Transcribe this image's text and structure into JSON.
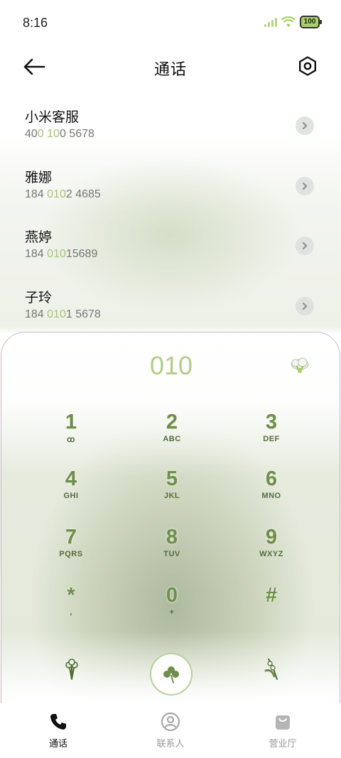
{
  "status": {
    "time": "8:16",
    "battery": "100"
  },
  "header": {
    "title": "通话"
  },
  "contacts": [
    {
      "name": "小米客服",
      "number_parts": [
        "40",
        "0",
        " ",
        "10",
        "0 5678"
      ]
    },
    {
      "name": "雅娜",
      "number_parts": [
        "184 ",
        "010",
        "2 4685"
      ]
    },
    {
      "name": "燕婷",
      "number_parts": [
        "184 ",
        "010",
        "15689"
      ]
    },
    {
      "name": "子玲",
      "number_parts": [
        "184 ",
        "010",
        "1 5678"
      ]
    }
  ],
  "dialpad": {
    "dialed": "010",
    "keys": [
      {
        "digit": "1",
        "letters": "ꝏ"
      },
      {
        "digit": "2",
        "letters": "ABC"
      },
      {
        "digit": "3",
        "letters": "DEF"
      },
      {
        "digit": "4",
        "letters": "GHI"
      },
      {
        "digit": "5",
        "letters": "JKL"
      },
      {
        "digit": "6",
        "letters": "MNO"
      },
      {
        "digit": "7",
        "letters": "PQRS"
      },
      {
        "digit": "8",
        "letters": "TUV"
      },
      {
        "digit": "9",
        "letters": "WXYZ"
      },
      {
        "digit": "*",
        "letters": ","
      },
      {
        "digit": "0",
        "letters": "+"
      },
      {
        "digit": "#",
        "letters": ""
      }
    ]
  },
  "tabs": [
    {
      "label": "通话",
      "icon": "phone-icon",
      "active": true
    },
    {
      "label": "联系人",
      "icon": "person-icon",
      "active": false
    },
    {
      "label": "营业厅",
      "icon": "bag-icon",
      "active": false
    }
  ],
  "colors": {
    "accent": "#b2cc89",
    "digit": "#6f8e4e",
    "highlight": "#a7c27a"
  }
}
